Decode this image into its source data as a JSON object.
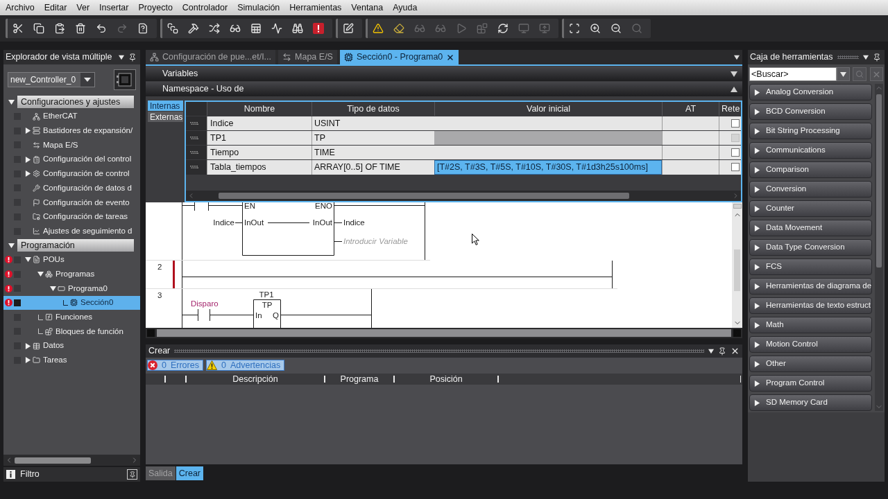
{
  "menu_bar": [
    "Archivo",
    "Editar",
    "Ver",
    "Insertar",
    "Proyecto",
    "Controlador",
    "Simulación",
    "Herramientas",
    "Ventana",
    "Ayuda"
  ],
  "toolbar": [
    [
      {
        "disabled": false
      },
      {
        "disabled": false
      },
      {
        "disabled": false
      },
      {
        "disabled": false
      },
      {
        "disabled": false
      },
      {
        "disabled": true
      },
      {
        "disabled": false
      }
    ],
    [
      {
        "disabled": false
      },
      {
        "disabled": false
      },
      {
        "disabled": false
      },
      {
        "disabled": false
      },
      {
        "disabled": false
      },
      {
        "disabled": false
      },
      {
        "disabled": false
      },
      {
        "disabled": false
      }
    ],
    [
      {
        "disabled": false
      }
    ],
    [
      {
        "disabled": false
      },
      {
        "disabled": false
      },
      {
        "disabled": true
      },
      {
        "disabled": true
      },
      {
        "disabled": true
      },
      {
        "disabled": true
      },
      {
        "disabled": false
      },
      {
        "disabled": true
      },
      {
        "disabled": true
      }
    ],
    [
      {
        "disabled": false
      },
      {
        "disabled": false
      },
      {
        "disabled": false
      },
      {
        "disabled": true
      }
    ]
  ],
  "explorer": {
    "title": "Explorador de vista múltiple",
    "controller": "new_Controller_0",
    "sections": [
      {
        "label": "Configuraciones y ajustes",
        "expanded": true,
        "items": [
          {
            "label": "EtherCAT",
            "kind": "network",
            "selected": false,
            "error": false
          },
          {
            "label": "Bastidores de expansión/",
            "kind": "rack",
            "expanded": false,
            "selected": false,
            "error": false
          },
          {
            "label": "Mapa E/S",
            "kind": "io-map",
            "selected": false,
            "error": false
          },
          {
            "label": "Configuración del control",
            "kind": "controller",
            "expanded": false,
            "selected": false,
            "error": false
          },
          {
            "label": "Configuración de control",
            "kind": "gear",
            "expanded": false,
            "selected": false,
            "error": false
          },
          {
            "label": "Configuración de datos d",
            "kind": "data",
            "selected": false,
            "error": false
          },
          {
            "label": "Configuración de evento",
            "kind": "event",
            "selected": false,
            "error": false
          },
          {
            "label": "Configuración de tareas",
            "kind": "tasks",
            "selected": false,
            "error": false
          },
          {
            "label": "Ajustes de seguimiento d",
            "kind": "trace",
            "selected": false,
            "error": false
          }
        ]
      },
      {
        "label": "Programación",
        "expanded": true,
        "items": [
          {
            "label": "POUs",
            "kind": "pou",
            "expanded": true,
            "selected": false,
            "error": true,
            "children": [
              {
                "label": "Programas",
                "kind": "programs",
                "expanded": true,
                "selected": false,
                "error": true,
                "children": [
                  {
                    "label": "Programa0",
                    "kind": "program",
                    "expanded": true,
                    "selected": false,
                    "error": true,
                    "children": [
                      {
                        "label": "Sección0",
                        "kind": "section",
                        "selected": true,
                        "error": true
                      }
                    ]
                  }
                ]
              },
              {
                "label": "Funciones",
                "kind": "functions",
                "selected": false,
                "error": false
              },
              {
                "label": "Bloques de función",
                "kind": "function-blocks",
                "selected": false,
                "error": false
              }
            ]
          },
          {
            "label": "Datos",
            "kind": "data-table",
            "expanded": false,
            "selected": false,
            "error": false
          },
          {
            "label": "Tareas",
            "kind": "tasks-folder",
            "expanded": false,
            "selected": false,
            "error": false
          }
        ]
      }
    ],
    "filter": "Filtro"
  },
  "document_tabs": [
    {
      "label": "Configuración de pue...et/I...",
      "kind": "ethernet",
      "selected": false
    },
    {
      "label": "Mapa E/S",
      "kind": "io-map",
      "selected": false
    },
    {
      "label": "Sección0 - Programa0",
      "kind": "section",
      "selected": true
    }
  ],
  "section_bars": [
    {
      "label": "Variables",
      "expanded": false
    },
    {
      "label": "Namespace - Uso de",
      "expanded": true
    }
  ],
  "variable_table": {
    "scope_tabs": [
      {
        "label": "Internas",
        "selected": true
      },
      {
        "label": "Externas",
        "selected": false
      }
    ],
    "columns": [
      "Nombre",
      "Tipo de datos",
      "Valor inicial",
      "AT",
      "Rete"
    ],
    "rows": [
      {
        "name": "Indice",
        "data_type": "USINT",
        "disabled": false,
        "value_selected": false,
        "retain": false
      },
      {
        "name": "TP1",
        "data_type": "TP",
        "disabled": true,
        "value_selected": false,
        "retain": false
      },
      {
        "name": "Tiempo",
        "data_type": "TIME",
        "disabled": false,
        "value_selected": false,
        "retain": false
      },
      {
        "name": "Tabla_tiempos",
        "data_type": "ARRAY[0..5] OF TIME",
        "initial_value": "[T#2S, T#3S, T#5S, T#10S, T#30S, T#1d3h25s100ms]",
        "disabled": false,
        "value_selected": true,
        "retain": false
      }
    ]
  },
  "ladder": {
    "rungs": [
      {
        "kind": "block",
        "en": "EN",
        "eno": "ENO",
        "in_pin": "InOut",
        "out_pin": "InOut",
        "input": "Indice",
        "output": "Indice",
        "placeholder": "Introducir Variable"
      },
      {
        "kind": "empty",
        "number": "2",
        "error": true
      },
      {
        "kind": "timer",
        "number": "3",
        "contact": "Disparo",
        "instance": "TP1",
        "type": "TP",
        "in_pin": "In",
        "out_pin": "Q"
      }
    ]
  },
  "build_panel": {
    "title": "Crear",
    "errors": {
      "count": "0",
      "label": "Errores"
    },
    "warnings": {
      "count": "0",
      "label": "Advertencias"
    },
    "columns": [
      "Descripción",
      "Programa",
      "Posición"
    ]
  },
  "bottom_tabs": [
    {
      "label": "Salida",
      "selected": false
    },
    {
      "label": "Crear",
      "selected": true
    }
  ],
  "toolbox": {
    "title": "Caja de herramientas",
    "search": {
      "placeholder": "<Buscar>"
    },
    "categories": [
      {
        "label": "Analog Conversion",
        "expanded": false
      },
      {
        "label": "BCD Conversion",
        "expanded": false
      },
      {
        "label": "Bit String Processing",
        "expanded": false
      },
      {
        "label": "Communications",
        "expanded": false
      },
      {
        "label": "Comparison",
        "expanded": false
      },
      {
        "label": "Conversion",
        "expanded": false
      },
      {
        "label": "Counter",
        "expanded": false
      },
      {
        "label": "Data Movement",
        "expanded": false
      },
      {
        "label": "Data Type Conversion",
        "expanded": false
      },
      {
        "label": "FCS",
        "expanded": false
      },
      {
        "label": "Herramientas de diagrama de",
        "expanded": false
      },
      {
        "label": "Herramientas de texto estruct",
        "expanded": false
      },
      {
        "label": "Math",
        "expanded": false
      },
      {
        "label": "Motion Control",
        "expanded": false
      },
      {
        "label": "Other",
        "expanded": false
      },
      {
        "label": "Program Control",
        "expanded": false
      },
      {
        "label": "SD Memory Card",
        "expanded": false
      }
    ]
  }
}
